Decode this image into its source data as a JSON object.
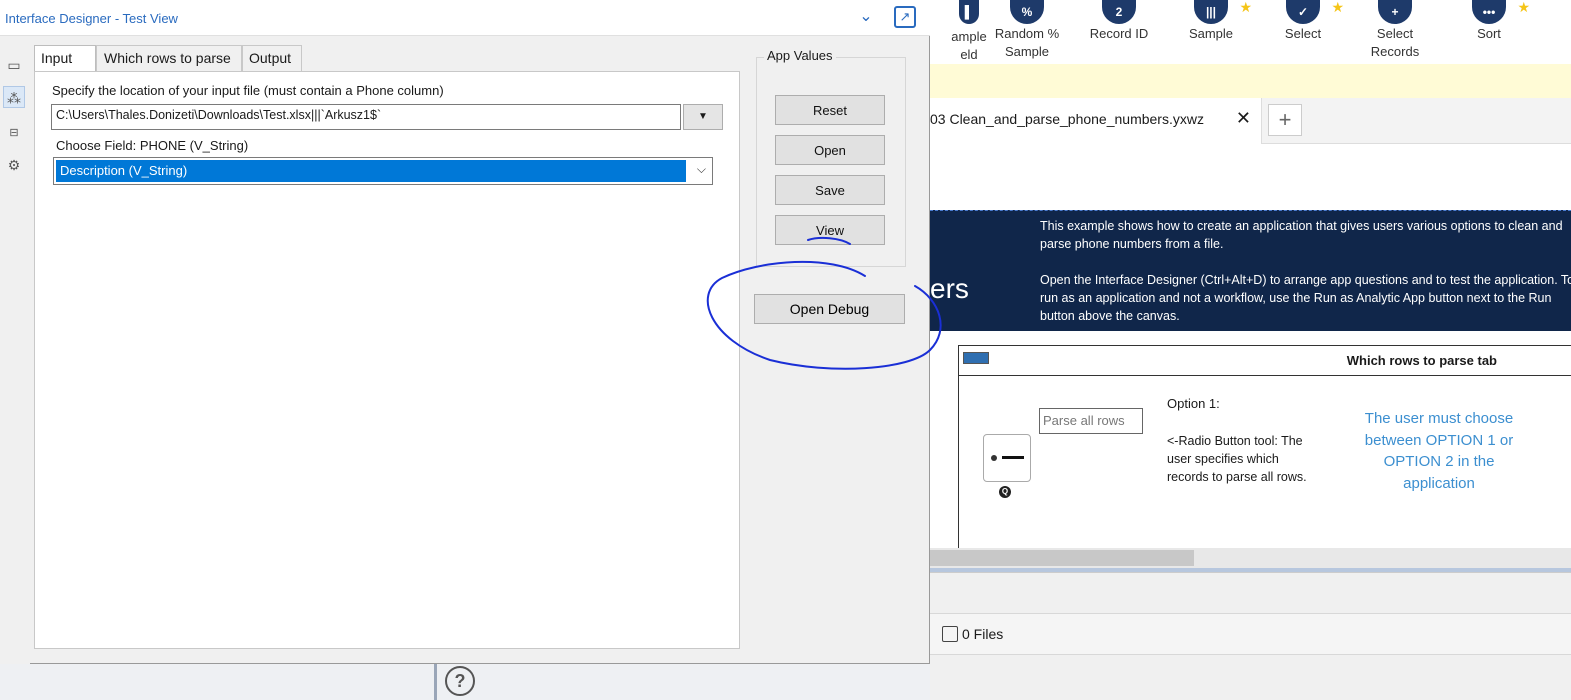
{
  "designer": {
    "title": "Interface Designer - Test View",
    "tabs": [
      "Input",
      "Which rows to parse",
      "Output"
    ],
    "location_label": "Specify the location of your input file (must contain a Phone column)",
    "path_value": "C:\\Users\\Thales.Donizeti\\Downloads\\Test.xlsx|||`Arkusz1$`",
    "field_label": "Choose Field: PHONE (V_String)",
    "field_selected": "Description (V_String)",
    "app_values_label": "App Values",
    "buttons": {
      "reset": "Reset",
      "open": "Open",
      "save": "Save",
      "view": "View"
    },
    "open_debug": "Open Debug"
  },
  "palette": {
    "tools": [
      {
        "label": "ample\neld",
        "glyph": ""
      },
      {
        "label": "Random %\nSample",
        "glyph": "%"
      },
      {
        "label": "Record ID",
        "glyph": "2"
      },
      {
        "label": "Sample",
        "glyph": "|||"
      },
      {
        "label": "Select",
        "glyph": "✓"
      },
      {
        "label": "Select\nRecords",
        "glyph": "+"
      },
      {
        "label": "Sort",
        "glyph": "•••"
      }
    ]
  },
  "workflow": {
    "tab_name": "03  Clean_and_parse_phone_numbers.yxwz",
    "banner_big": "ers",
    "banner_p1": "This example shows how to create an application that gives users various options to clean and parse phone numbers from a file.",
    "banner_p2": "Open the Interface Designer (Ctrl+Alt+D) to arrange app questions and to test the application. To run as an application and not a workflow, use the Run as Analytic App button next to the Run button above the canvas.",
    "tab_box_title": "Which rows to parse tab",
    "parse_all_rows": "Parse all rows",
    "option1_title": "Option 1:",
    "option1_text": "<-Radio Button tool: The user specifies which records to parse all rows.",
    "choose_text": "The user must choose between OPTION 1 or OPTION 2 in the application",
    "files_label": "0 Files"
  },
  "colors": {
    "accent": "#2a6bbf",
    "selection": "#0078d7",
    "banner_bg": "#10264a",
    "annotation": "#1a2fd6",
    "choose_text": "#3c8fd0"
  }
}
